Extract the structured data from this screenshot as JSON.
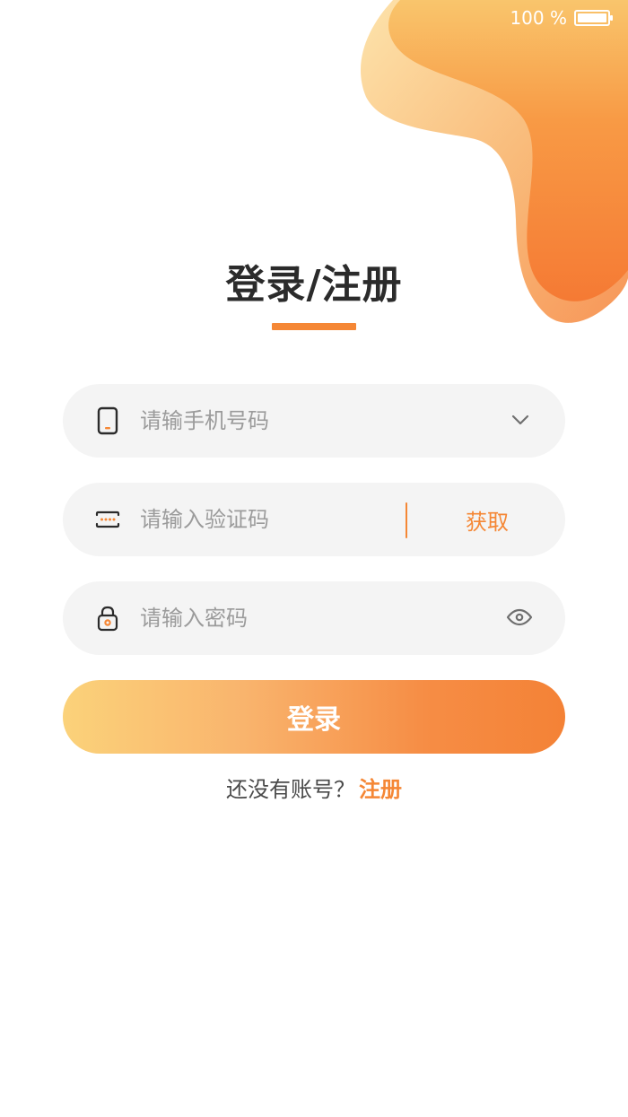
{
  "status_bar": {
    "battery_text": "100 %"
  },
  "icons": {
    "phone": "phone-icon",
    "verification_code": "verification-code-icon",
    "lock": "lock-icon",
    "dropdown": "chevron-down-icon",
    "visibility": "eye-icon"
  },
  "colors": {
    "accent": "#f58735",
    "field_background": "#f4f4f4",
    "title_text": "#2b2b2b",
    "placeholder_text": "#9b9b9b",
    "button_gradient": [
      "#fbd27a",
      "#f48236"
    ]
  },
  "header": {
    "title": "登录/注册"
  },
  "form": {
    "phone": {
      "value": "",
      "placeholder": "请输手机号码"
    },
    "code": {
      "value": "",
      "placeholder": "请输入验证码",
      "action_label": "获取"
    },
    "password": {
      "value": "",
      "placeholder": "请输入密码"
    },
    "submit_label": "登录"
  },
  "footer": {
    "prompt": "还没有账号？",
    "register_label": "注册"
  }
}
